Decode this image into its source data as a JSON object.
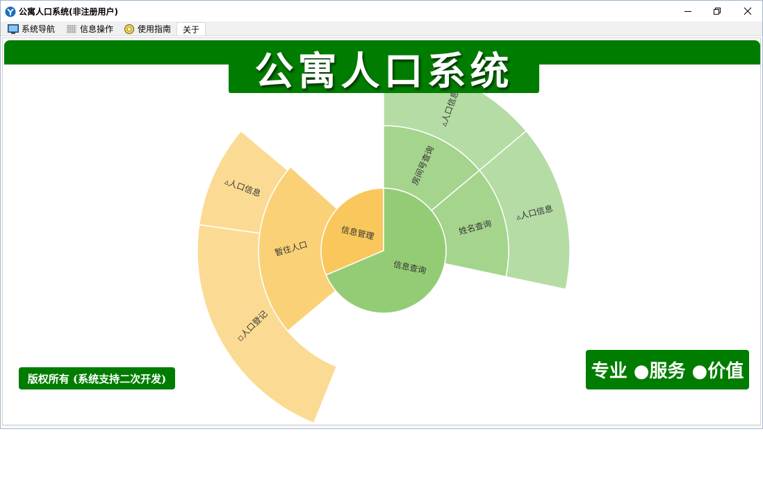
{
  "window": {
    "title": "公寓人口系统(非注册用户)"
  },
  "menu": {
    "items": [
      {
        "label": "系统导航",
        "icon": "monitor-icon"
      },
      {
        "label": "信息操作",
        "icon": "grid-icon"
      },
      {
        "label": "使用指南",
        "icon": "guide-icon"
      },
      {
        "label": "关于",
        "icon": ""
      }
    ]
  },
  "banner": {
    "title": "公寓人口系统"
  },
  "sunburst": {
    "colors": {
      "orange_inner": "#f9c75b",
      "orange_mid": "#fad177",
      "orange_outer": "#fbdb93",
      "green_inner": "#94cc76",
      "green_mid": "#a5d48d",
      "green_outer": "#b5dca4"
    },
    "labels": {
      "inner_left": "信息管理",
      "inner_right": "信息查询",
      "mid_left": "暂住人口",
      "mid_right_top": "房间号查询",
      "mid_right_bottom": "姓名查询",
      "outer_left_top": "▵人口信息",
      "outer_left_bottom": "▫人口登记",
      "outer_right_top": "▵人口信息",
      "outer_right_bottom": "▵人口信息"
    }
  },
  "footer": {
    "copyright": "版权所有 (系统支持二次开发)",
    "slogan": "专业 ●服务 ●价值"
  }
}
